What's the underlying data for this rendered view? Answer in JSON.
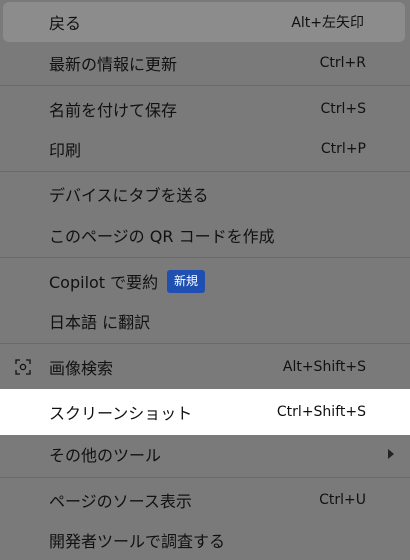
{
  "menu": {
    "items": [
      {
        "label": "戻る",
        "shortcut": "Alt+左矢印"
      },
      {
        "label": "最新の情報に更新",
        "shortcut": "Ctrl+R"
      },
      {
        "label": "名前を付けて保存",
        "shortcut": "Ctrl+S"
      },
      {
        "label": "印刷",
        "shortcut": "Ctrl+P"
      },
      {
        "label": "デバイスにタブを送る",
        "shortcut": ""
      },
      {
        "label": "このページの QR コードを作成",
        "shortcut": ""
      },
      {
        "label": "Copilot で要約",
        "shortcut": "",
        "badge": "新規"
      },
      {
        "label": "日本語 に翻訳",
        "shortcut": ""
      },
      {
        "label": "画像検索",
        "shortcut": "Alt+Shift+S",
        "icon": "visual-search-icon"
      },
      {
        "label": "スクリーンショット",
        "shortcut": "Ctrl+Shift+S"
      },
      {
        "label": "その他のツール",
        "shortcut": "",
        "icon": "chevron-right-icon"
      },
      {
        "label": "ページのソース表示",
        "shortcut": "Ctrl+U"
      },
      {
        "label": "開発者ツールで調査する",
        "shortcut": ""
      }
    ]
  },
  "colors": {
    "menu_background": "#7a7a7a",
    "hover_background": "#8c8c8c",
    "selected_background": "#ffffff",
    "badge_background": "#1f4fb0",
    "separator": "#6a6a6a",
    "text": "#111111"
  }
}
